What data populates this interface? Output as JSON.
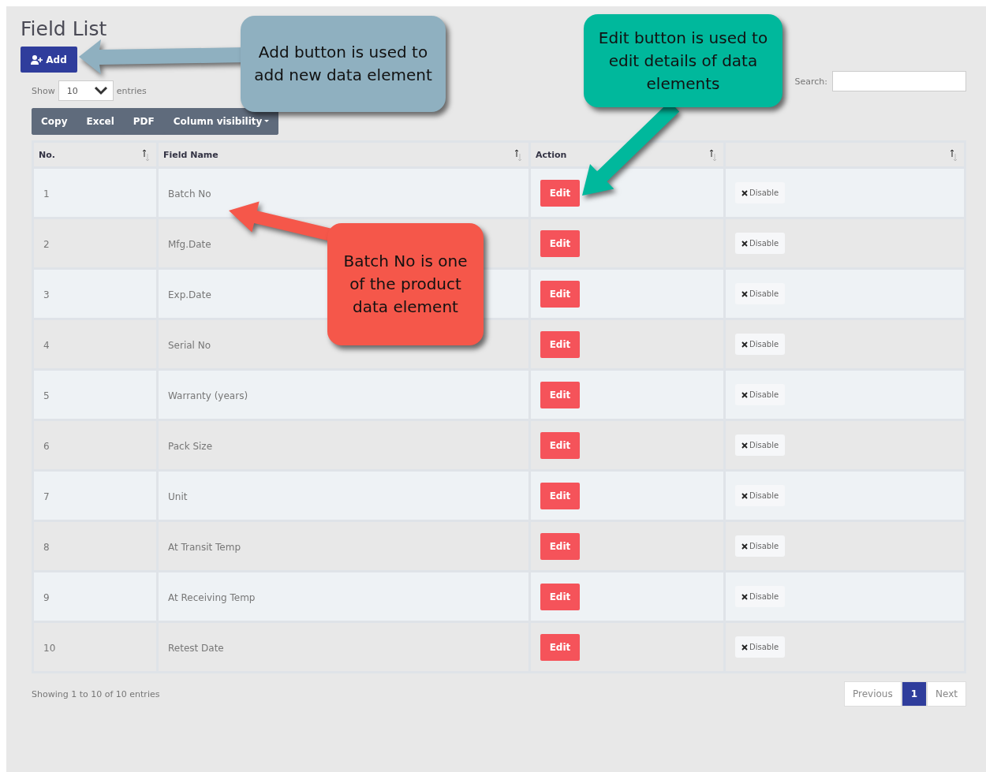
{
  "title": "Field List",
  "add_button": {
    "label": "Add"
  },
  "length": {
    "label_before": "Show",
    "value": "10",
    "label_after": "entries"
  },
  "search": {
    "label": "Search:"
  },
  "export_buttons": [
    {
      "label": "Copy",
      "kind": "plain"
    },
    {
      "label": "Excel",
      "kind": "plain"
    },
    {
      "label": "PDF",
      "kind": "plain"
    },
    {
      "label": "Column visibility",
      "kind": "dropdown"
    }
  ],
  "table": {
    "columns": [
      "No.",
      "Field Name",
      "Action"
    ],
    "rows": [
      {
        "no": "1",
        "field": "Batch No",
        "edit": "Edit",
        "disable": "Disable"
      },
      {
        "no": "2",
        "field": "Mfg.Date",
        "edit": "Edit",
        "disable": "Disable"
      },
      {
        "no": "3",
        "field": "Exp.Date",
        "edit": "Edit",
        "disable": "Disable"
      },
      {
        "no": "4",
        "field": "Serial No",
        "edit": "Edit",
        "disable": "Disable"
      },
      {
        "no": "5",
        "field": "Warranty (years)",
        "edit": "Edit",
        "disable": "Disable"
      },
      {
        "no": "6",
        "field": "Pack Size",
        "edit": "Edit",
        "disable": "Disable"
      },
      {
        "no": "7",
        "field": "Unit",
        "edit": "Edit",
        "disable": "Disable"
      },
      {
        "no": "8",
        "field": "At Transit Temp",
        "edit": "Edit",
        "disable": "Disable"
      },
      {
        "no": "9",
        "field": "At Receiving Temp",
        "edit": "Edit",
        "disable": "Disable"
      },
      {
        "no": "10",
        "field": "Retest Date",
        "edit": "Edit",
        "disable": "Disable"
      }
    ]
  },
  "info": "Showing 1 to 10 of 10 entries",
  "pagination": {
    "previous": "Previous",
    "pages": [
      {
        "label": "1",
        "selected": true
      }
    ],
    "next": "Next"
  },
  "callouts": [
    {
      "kind": "add",
      "text": "Add button is used to add new data element",
      "color": "#8fb0c0"
    },
    {
      "kind": "edit",
      "text": "Edit button is used to edit details of data elements",
      "color": "#00b89c"
    },
    {
      "kind": "field",
      "text": "Batch No is one of the product data element",
      "color": "#f5574a"
    }
  ]
}
